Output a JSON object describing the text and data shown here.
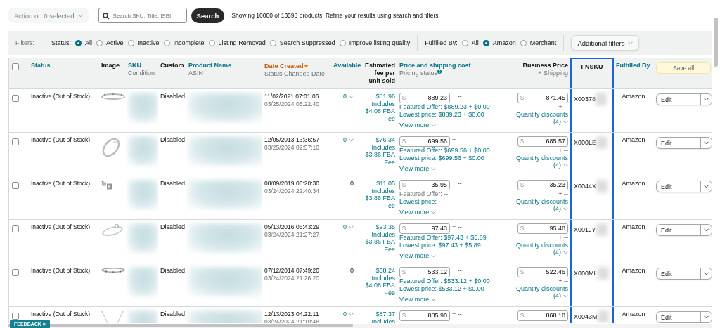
{
  "toolbar": {
    "action_menu": "Action on 0 selected",
    "search": {
      "placeholder": "Search SKU, Title, ISBI"
    },
    "search_button": "Search",
    "result_info": "Showing 10000 of 13598 products. Refine your results using search and filters."
  },
  "filters": {
    "label": "Filters:",
    "status": {
      "label": "Status:",
      "options": [
        {
          "label": "All",
          "selected": true
        },
        {
          "label": "Active",
          "selected": false
        },
        {
          "label": "Inactive",
          "selected": false
        },
        {
          "label": "Incomplete",
          "selected": false
        },
        {
          "label": "Listing Removed",
          "selected": false
        },
        {
          "label": "Search Suppressed",
          "selected": false
        },
        {
          "label": "Improve listing quality",
          "selected": false
        }
      ]
    },
    "fulfilled_by": {
      "label": "Fulfilled By:",
      "options": [
        {
          "label": "All",
          "selected": false
        },
        {
          "label": "Amazon",
          "selected": true
        },
        {
          "label": "Merchant",
          "selected": false
        }
      ]
    },
    "additional_filters": "Additional filters"
  },
  "table": {
    "select_all": {
      "checked": false
    },
    "save_all_button": "Save all",
    "columns": [
      {
        "title": "Status",
        "kind": "link"
      },
      {
        "title": "Image",
        "kind": "plain"
      },
      {
        "title": "SKU",
        "subtitle": "Condition",
        "kind": "link"
      },
      {
        "title": "Custom",
        "kind": "plain"
      },
      {
        "title": "Product Name",
        "subtitle": "ASIN",
        "kind": "link"
      },
      {
        "title": "Date Created",
        "subtitle": "Status Changed Date",
        "kind": "sorted"
      },
      {
        "title": "Available",
        "kind": "link"
      },
      {
        "title": "Estimated fee per unit sold",
        "kind": "plain"
      },
      {
        "title": "Price and shipping cost",
        "subtitle": "Pricing status",
        "kind": "link",
        "info": true
      },
      {
        "title": "Business Price",
        "subtitle": "+ Shipping",
        "kind": "plain"
      },
      {
        "title": "FNSKU",
        "kind": "plain",
        "highlighted": true
      },
      {
        "title": "Fulfilled By",
        "kind": "link"
      }
    ],
    "rows": [
      {
        "checked": false,
        "status": "Inactive (Out of Stock)",
        "custom": "Disabled",
        "date_created": "11/02/2021 07:01:06",
        "status_changed": "03/25/2024 05:22:40",
        "available": {
          "value": "0",
          "expandable": true
        },
        "fee": [
          "$81.96",
          "Includes",
          "$4.08 FBA",
          "Fee"
        ],
        "price": {
          "currency": "$",
          "value": "889.23",
          "shipping": "+ --",
          "featured": {
            "text": "Featured Offer: $889.23 + $0.00",
            "muted": false
          },
          "lowest": "Lowest price: $889.23 + $0.00",
          "view_more": "View more"
        },
        "business": {
          "currency": "$",
          "value": "871.45",
          "shipping": "+ --",
          "discounts": "Quantity discounts",
          "discount_count": "(4)"
        },
        "fnsku": "X00378",
        "fulfilled_by": "Amazon",
        "action": "Edit"
      },
      {
        "checked": false,
        "status": "Inactive (Out of Stock)",
        "custom": "Disabled",
        "date_created": "12/05/2013 13:36:57",
        "status_changed": "03/25/2024 02:57:10",
        "available": {
          "value": "0",
          "expandable": true
        },
        "fee": [
          "$76.34",
          "Includes",
          "$3.86 FBA",
          "Fee"
        ],
        "price": {
          "currency": "$",
          "value": "699.56",
          "shipping": "+ --",
          "featured": {
            "text": "Featured Offer: $699.56 + $0.00",
            "muted": false
          },
          "lowest": "Lowest price: $699.56 + $0.00",
          "view_more": "View more"
        },
        "business": {
          "currency": "$",
          "value": "685.57",
          "shipping": "+ --",
          "discounts": "Quantity discounts",
          "discount_count": "(4)"
        },
        "fnsku": "X000LE",
        "fulfilled_by": "Amazon",
        "action": "Edit"
      },
      {
        "checked": false,
        "status": "Inactive (Out of Stock)",
        "custom": "Disabled",
        "date_created": "08/09/2019 06:20:30",
        "status_changed": "03/24/2024 22:40:34",
        "available": {
          "value": "0",
          "expandable": false
        },
        "fee": [
          "$11.05",
          "Includes",
          "$3.86 FBA",
          "Fee"
        ],
        "price": {
          "currency": "$",
          "value": "35.95",
          "shipping": "+ --",
          "featured": {
            "text": "Featured Offer: --",
            "muted": true
          },
          "lowest": "Lowest price: --",
          "view_more": "View more"
        },
        "business": {
          "currency": "$",
          "value": "35.23",
          "shipping": "+ --",
          "discounts": "Quantity discounts",
          "discount_count": "(4)"
        },
        "fnsku": "X0044X",
        "fulfilled_by": "Amazon",
        "action": "Edit"
      },
      {
        "checked": false,
        "status": "Inactive (Out of Stock)",
        "custom": "Disabled",
        "date_created": "05/13/2016 06:43:29",
        "status_changed": "03/24/2024 21:27:27",
        "available": {
          "value": "0",
          "expandable": true
        },
        "fee": [
          "$23.35",
          "Includes",
          "$3.86 FBA",
          "Fee"
        ],
        "price": {
          "currency": "$",
          "value": "97.43",
          "shipping": "+ --",
          "featured": {
            "text": "Featured Offer: $97.43 + $5.89",
            "muted": false
          },
          "lowest": "Lowest price: $97.43 + $5.89",
          "view_more": "View more"
        },
        "business": {
          "currency": "$",
          "value": "95.48",
          "shipping": "+ --",
          "discounts": "Quantity discounts",
          "discount_count": "(4)"
        },
        "fnsku": "X001JY",
        "fulfilled_by": "Amazon",
        "action": "Edit"
      },
      {
        "checked": false,
        "status": "Inactive (Out of Stock)",
        "custom": "Disabled",
        "date_created": "07/12/2014 07:49:20",
        "status_changed": "03/24/2024 21:26:20",
        "available": {
          "value": "0",
          "expandable": false
        },
        "fee": [
          "$68.24",
          "Includes",
          "$4.08 FBA",
          "Fee"
        ],
        "price": {
          "currency": "$",
          "value": "533.12",
          "shipping": "+ --",
          "featured": {
            "text": "Featured Offer: $533.12 + $0.00",
            "muted": false
          },
          "lowest": "Lowest price: $533.12 + $0.00",
          "view_more": "View more"
        },
        "business": {
          "currency": "$",
          "value": "522.46",
          "shipping": "+ --",
          "discounts": "Quantity discounts",
          "discount_count": "(4)"
        },
        "fnsku": "X000ML",
        "fulfilled_by": "Amazon",
        "action": "Edit"
      },
      {
        "checked": false,
        "status": "Inactive (Out of Stock)",
        "custom": "Disabled",
        "date_created": "12/13/2023 04:22:11",
        "status_changed": "03/24/2024 21:19:48",
        "available": {
          "value": "0",
          "expandable": true
        },
        "fee": [
          "$87.37",
          "Includes"
        ],
        "price": {
          "currency": "$",
          "value": "885.90",
          "shipping": "+ --"
        },
        "business": {
          "currency": "$",
          "value": "868.18"
        },
        "fnsku": "X0043M",
        "fulfilled_by": "Amazon",
        "action": "Edit"
      }
    ]
  },
  "feedback": {
    "label": "FEEDBACK",
    "close": "×"
  }
}
